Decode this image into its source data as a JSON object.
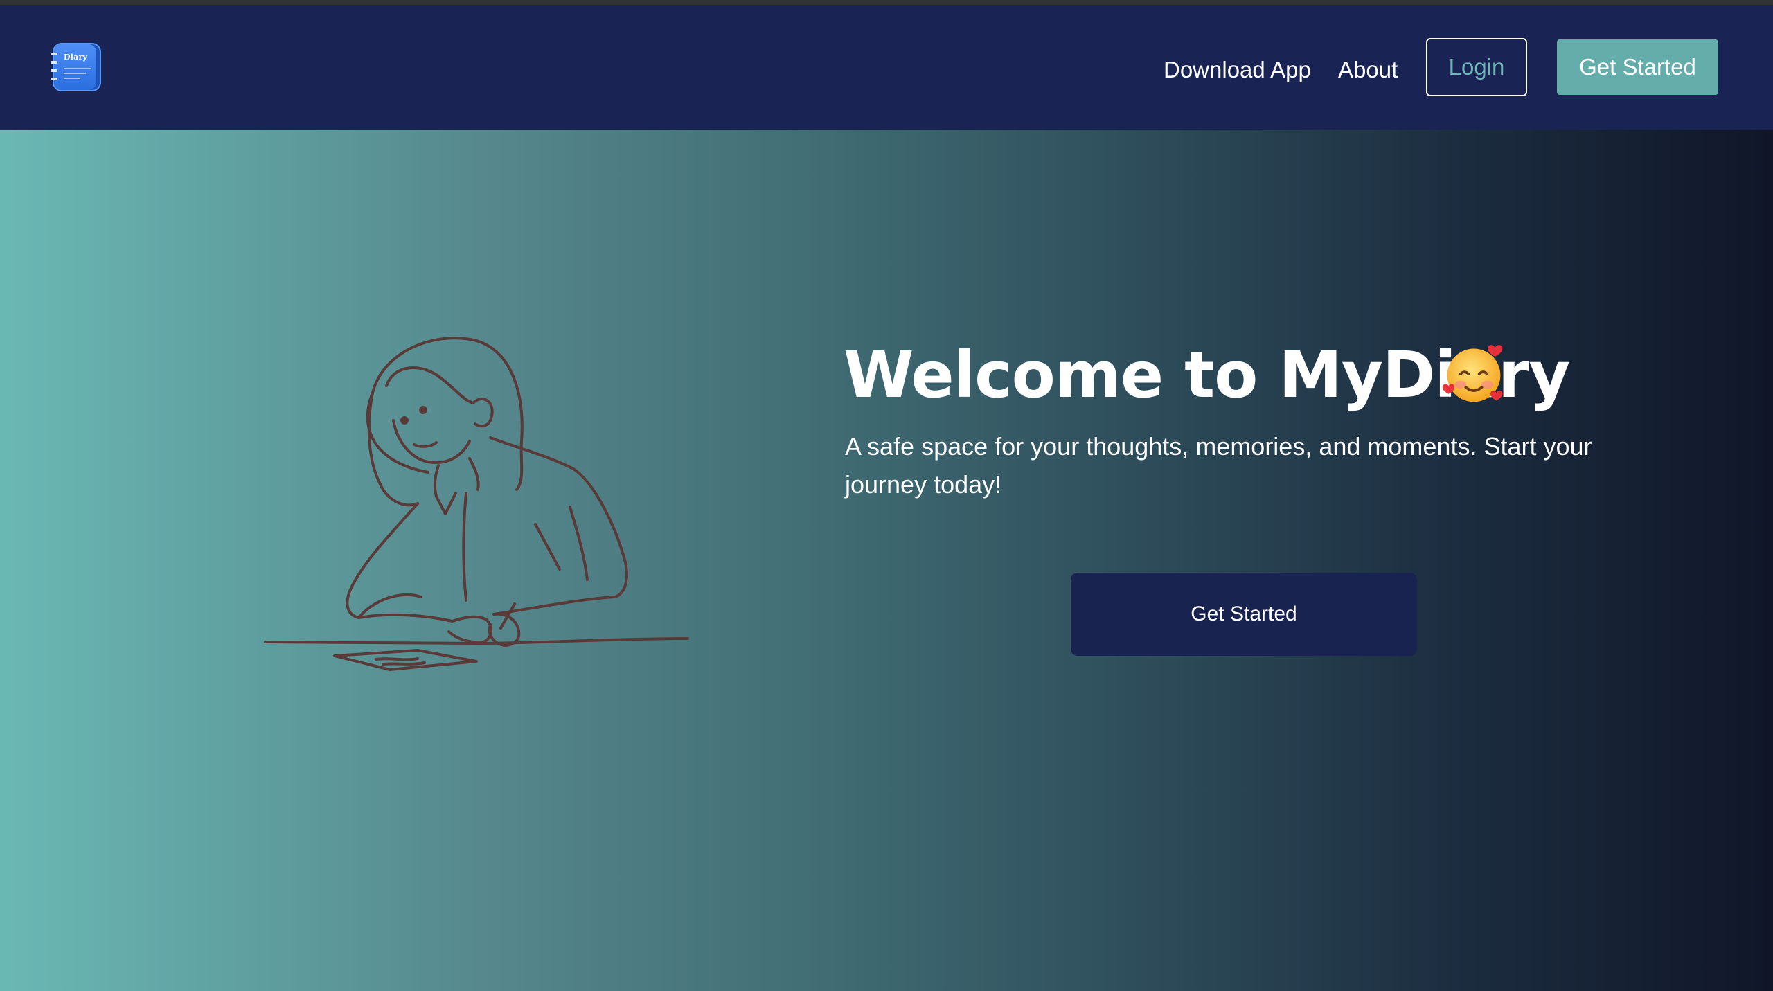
{
  "nav": {
    "logo_label": "Diary",
    "download_label": "Download App",
    "about_label": "About",
    "login_label": "Login",
    "get_started_label": "Get Started"
  },
  "hero": {
    "title": "Welcome to MyDiary",
    "emoji": "smiling-face-with-hearts",
    "subtitle": "A safe space for your thoughts, memories, and moments. Start your journey today!",
    "cta_label": "Get Started",
    "illustration": "woman-writing-illustration"
  },
  "colors": {
    "navbar_bg": "#192454",
    "accent_teal": "#65adab",
    "login_text": "#6fb6b6",
    "hero_gradient_start": "#6ab8b5",
    "hero_gradient_end": "#101628",
    "cta_bg": "#19234f",
    "illustration_stroke": "#5a3a38"
  }
}
